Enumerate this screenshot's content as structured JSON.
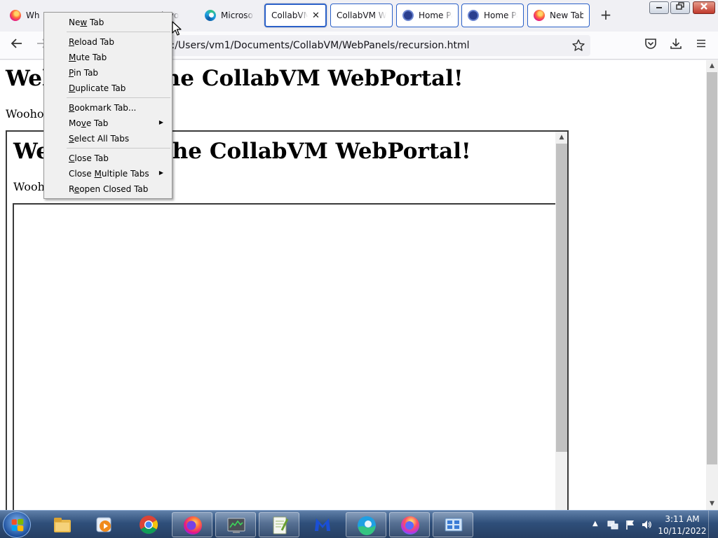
{
  "tabs": [
    {
      "label": "What",
      "icon": "firefox-icon"
    },
    {
      "label": "",
      "icon": "green-icon"
    },
    {
      "label": "k yo",
      "icon": "firefox-icon"
    },
    {
      "label": "Microsoft",
      "icon": "edge-icon"
    },
    {
      "label": "CollabVM W",
      "icon": "none",
      "selected": true
    },
    {
      "label": "CollabVM We",
      "icon": "none"
    },
    {
      "label": "Home Pa",
      "icon": "pbs-icon"
    },
    {
      "label": "Home Pa",
      "icon": "pbs-icon"
    },
    {
      "label": "New Tab",
      "icon": "firefox-icon"
    }
  ],
  "toolbar": {
    "url": "/C:/Users/vm1/Documents/CollabVM/WebPanels/recursion.html",
    "new_tab_symbol": "+",
    "close_tab_symbol": "✕"
  },
  "page": {
    "heading": "Welcome to the CollabVM WebPortal!",
    "text": "Woohoo",
    "inner_heading": "Welcome to the CollabVM WebPortal!",
    "inner_text": "Woohoo"
  },
  "context_menu": {
    "items": [
      {
        "label": "New Tab",
        "accel_index": 2
      },
      {
        "label": "Reload Tab",
        "accel_index": 0
      },
      {
        "label": "Mute Tab",
        "accel_index": 0
      },
      {
        "label": "Pin Tab",
        "accel_index": 0
      },
      {
        "label": "Duplicate Tab",
        "accel_index": 0
      },
      {
        "label": "Bookmark Tab...",
        "accel_index": 0
      },
      {
        "label": "Move Tab",
        "accel_index": 2,
        "submenu": true
      },
      {
        "label": "Select All Tabs",
        "accel_index": 0
      },
      {
        "label": "Close Tab",
        "accel_index": 0
      },
      {
        "label": "Close Multiple Tabs",
        "accel_index": 6,
        "submenu": true
      },
      {
        "label": "Reopen Closed Tab",
        "accel_index": 1
      }
    ]
  },
  "taskbar": {
    "apps": [
      "start",
      "file-explorer",
      "media-player",
      "chrome",
      "firefox",
      "task-manager",
      "notepad-plus",
      "malwarebytes",
      "edge",
      "firefox-dev",
      "control-panel"
    ],
    "time": "3:11 AM",
    "date": "10/11/2022"
  },
  "colors": {
    "accent": "#2a60c8",
    "taskbar": "#2f4f7a"
  }
}
